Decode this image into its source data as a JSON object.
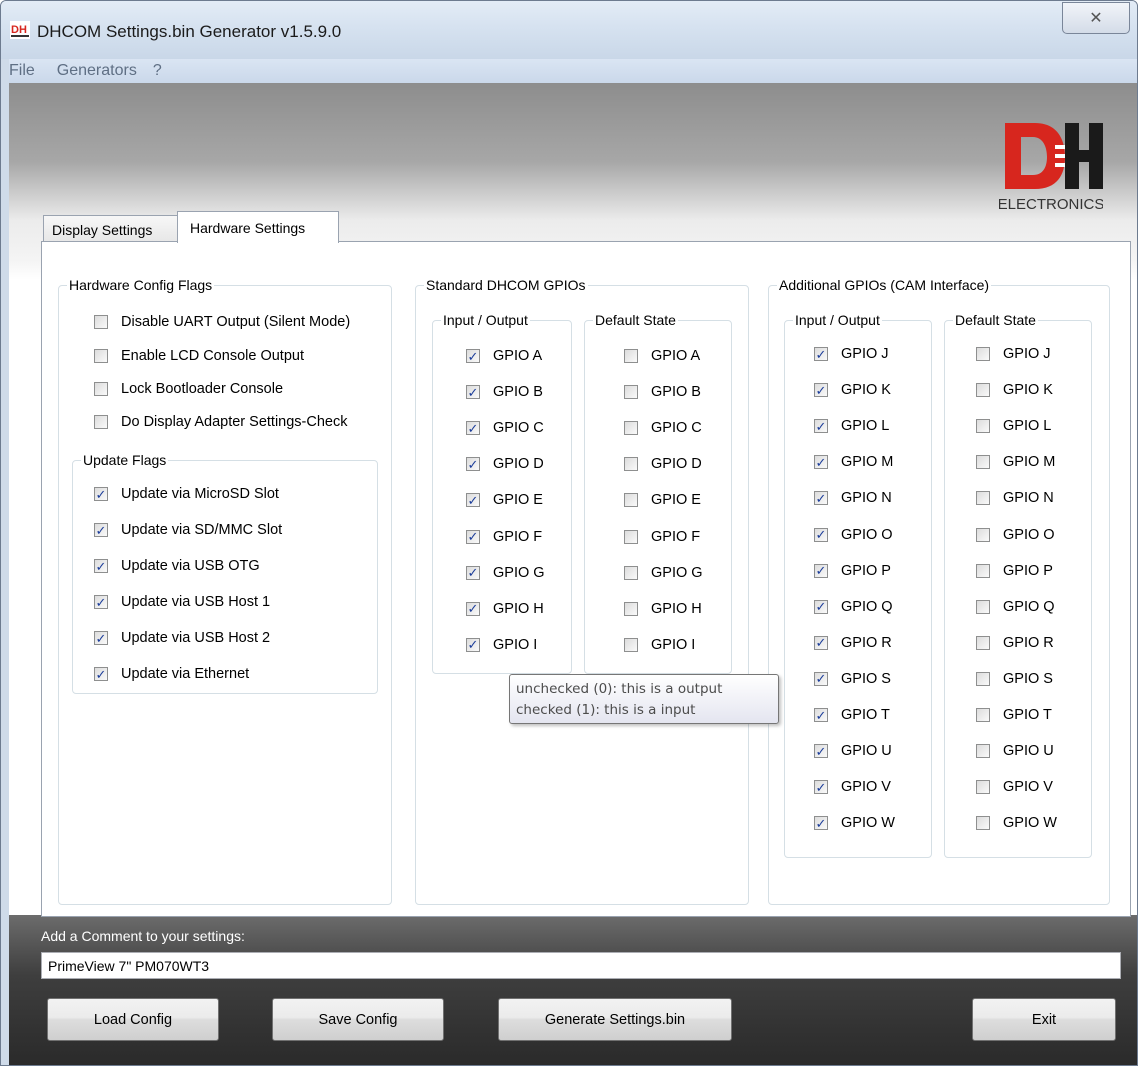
{
  "window": {
    "title": "DHCOM Settings.bin Generator v1.5.9.0",
    "close_glyph": "✕",
    "app_icon_text": "DH"
  },
  "menu": [
    "File",
    "Generators",
    "?"
  ],
  "logo": {
    "mark": "DH",
    "text": "ELECTRONICS",
    "color": "#d7261e"
  },
  "tabs": [
    {
      "label": "Display Settings",
      "active": false
    },
    {
      "label": "Hardware Settings",
      "active": true
    }
  ],
  "hardware_config": {
    "legend": "Hardware Config Flags",
    "flags": [
      {
        "label": "Disable UART Output (Silent Mode)",
        "checked": false
      },
      {
        "label": "Enable LCD Console Output",
        "checked": false
      },
      {
        "label": "Lock Bootloader Console",
        "checked": false
      },
      {
        "label": "Do Display Adapter Settings-Check",
        "checked": false
      }
    ]
  },
  "update_flags": {
    "legend": "Update Flags",
    "flags": [
      {
        "label": "Update via MicroSD Slot",
        "checked": true
      },
      {
        "label": "Update via SD/MMC Slot",
        "checked": true
      },
      {
        "label": "Update via USB OTG",
        "checked": true
      },
      {
        "label": "Update via USB Host 1",
        "checked": true
      },
      {
        "label": "Update via USB Host 2",
        "checked": true
      },
      {
        "label": "Update via Ethernet",
        "checked": true
      }
    ]
  },
  "standard_gpios": {
    "legend": "Standard DHCOM GPIOs",
    "io_legend": "Input / Output",
    "default_legend": "Default State",
    "io": [
      {
        "label": "GPIO A",
        "checked": true
      },
      {
        "label": "GPIO B",
        "checked": true
      },
      {
        "label": "GPIO C",
        "checked": true
      },
      {
        "label": "GPIO D",
        "checked": true
      },
      {
        "label": "GPIO E",
        "checked": true
      },
      {
        "label": "GPIO F",
        "checked": true
      },
      {
        "label": "GPIO G",
        "checked": true
      },
      {
        "label": "GPIO H",
        "checked": true
      },
      {
        "label": "GPIO I",
        "checked": true
      }
    ],
    "default": [
      {
        "label": "GPIO A",
        "checked": false
      },
      {
        "label": "GPIO B",
        "checked": false
      },
      {
        "label": "GPIO C",
        "checked": false
      },
      {
        "label": "GPIO D",
        "checked": false
      },
      {
        "label": "GPIO E",
        "checked": false
      },
      {
        "label": "GPIO F",
        "checked": false
      },
      {
        "label": "GPIO G",
        "checked": false
      },
      {
        "label": "GPIO H",
        "checked": false
      },
      {
        "label": "GPIO I",
        "checked": false
      }
    ]
  },
  "additional_gpios": {
    "legend": "Additional GPIOs (CAM Interface)",
    "io_legend": "Input / Output",
    "default_legend": "Default State",
    "io": [
      {
        "label": "GPIO J",
        "checked": true
      },
      {
        "label": "GPIO K",
        "checked": true
      },
      {
        "label": "GPIO L",
        "checked": true
      },
      {
        "label": "GPIO M",
        "checked": true
      },
      {
        "label": "GPIO N",
        "checked": true
      },
      {
        "label": "GPIO O",
        "checked": true
      },
      {
        "label": "GPIO P",
        "checked": true
      },
      {
        "label": "GPIO Q",
        "checked": true
      },
      {
        "label": "GPIO R",
        "checked": true
      },
      {
        "label": "GPIO S",
        "checked": true
      },
      {
        "label": "GPIO T",
        "checked": true
      },
      {
        "label": "GPIO U",
        "checked": true
      },
      {
        "label": "GPIO V",
        "checked": true
      },
      {
        "label": "GPIO W",
        "checked": true
      }
    ],
    "default": [
      {
        "label": "GPIO J",
        "checked": false
      },
      {
        "label": "GPIO K",
        "checked": false
      },
      {
        "label": "GPIO L",
        "checked": false
      },
      {
        "label": "GPIO M",
        "checked": false
      },
      {
        "label": "GPIO N",
        "checked": false
      },
      {
        "label": "GPIO O",
        "checked": false
      },
      {
        "label": "GPIO P",
        "checked": false
      },
      {
        "label": "GPIO Q",
        "checked": false
      },
      {
        "label": "GPIO R",
        "checked": false
      },
      {
        "label": "GPIO S",
        "checked": false
      },
      {
        "label": "GPIO T",
        "checked": false
      },
      {
        "label": "GPIO U",
        "checked": false
      },
      {
        "label": "GPIO V",
        "checked": false
      },
      {
        "label": "GPIO W",
        "checked": false
      }
    ]
  },
  "tooltip": {
    "line1": "unchecked (0): this is a output",
    "line2": "checked (1): this is a input"
  },
  "comment": {
    "label": "Add a Comment to your settings:",
    "value": "PrimeView 7\" PM070WT3"
  },
  "buttons": {
    "load": "Load Config",
    "save": "Save Config",
    "generate": "Generate Settings.bin",
    "exit": "Exit"
  }
}
